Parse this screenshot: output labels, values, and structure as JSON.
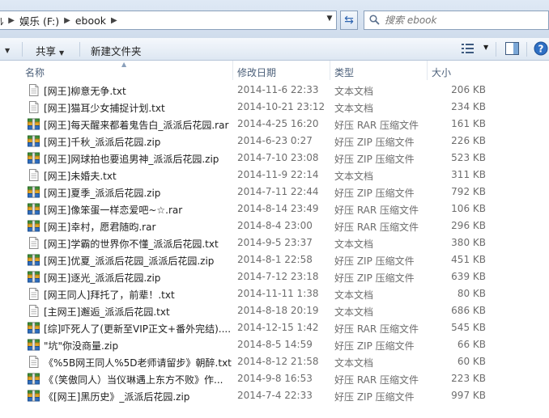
{
  "address": {
    "segments": [
      "ﾙ",
      "娱乐 (F:)",
      "ebook"
    ]
  },
  "search": {
    "placeholder": "搜索 ebook"
  },
  "toolbar": {
    "share_label": "共享",
    "new_folder_label": "新建文件夹"
  },
  "columns": {
    "name": "名称",
    "date": "修改日期",
    "type": "类型",
    "size": "大小"
  },
  "files": [
    {
      "name": "[网王]柳意无争.txt",
      "date": "2014-11-6 22:33",
      "type": "文本文档",
      "size": "206 KB",
      "icon": "text-file-icon"
    },
    {
      "name": "[网王]猫耳少女捕捉计划.txt",
      "date": "2014-10-21 23:12",
      "type": "文本文档",
      "size": "234 KB",
      "icon": "text-file-icon"
    },
    {
      "name": "[网王]每天醒来都着鬼告白_派派后花园.rar",
      "date": "2014-4-25 16:20",
      "type": "好压 RAR 压缩文件",
      "size": "161 KB",
      "icon": "archive-icon"
    },
    {
      "name": "[网王]千秋_派派后花园.zip",
      "date": "2014-6-23 0:27",
      "type": "好压 ZIP 压缩文件",
      "size": "226 KB",
      "icon": "archive-icon"
    },
    {
      "name": "[网王]网球拍也要追男神_派派后花园.zip",
      "date": "2014-7-10 23:08",
      "type": "好压 ZIP 压缩文件",
      "size": "523 KB",
      "icon": "archive-icon"
    },
    {
      "name": "[网王]未婚夫.txt",
      "date": "2014-11-9 22:14",
      "type": "文本文档",
      "size": "311 KB",
      "icon": "text-file-icon"
    },
    {
      "name": "[网王]夏季_派派后花园.zip",
      "date": "2014-7-11 22:44",
      "type": "好压 ZIP 压缩文件",
      "size": "792 KB",
      "icon": "archive-icon"
    },
    {
      "name": "[网王]像笨蛋一样恋爱吧~☆.rar",
      "date": "2014-8-14 23:49",
      "type": "好压 RAR 压缩文件",
      "size": "106 KB",
      "icon": "archive-icon"
    },
    {
      "name": "[网王]幸村，愿君随昀.rar",
      "date": "2014-8-4 23:00",
      "type": "好压 RAR 压缩文件",
      "size": "296 KB",
      "icon": "archive-icon"
    },
    {
      "name": "[网王]学霸的世界你不懂_派派后花园.txt",
      "date": "2014-9-5 23:37",
      "type": "文本文档",
      "size": "380 KB",
      "icon": "text-file-icon"
    },
    {
      "name": "[网王]优夏_派派后花园_派派后花园.zip",
      "date": "2014-8-1 22:58",
      "type": "好压 ZIP 压缩文件",
      "size": "451 KB",
      "icon": "archive-icon"
    },
    {
      "name": "[网王]逐光_派派后花园.zip",
      "date": "2014-7-12 23:18",
      "type": "好压 ZIP 压缩文件",
      "size": "639 KB",
      "icon": "archive-icon"
    },
    {
      "name": "[网王同人]拜托了，前辈！.txt",
      "date": "2014-11-11 1:38",
      "type": "文本文档",
      "size": "80 KB",
      "icon": "text-file-icon"
    },
    {
      "name": "[主网王]邂逅_派派后花园.txt",
      "date": "2014-8-18 20:19",
      "type": "文本文档",
      "size": "686 KB",
      "icon": "text-file-icon"
    },
    {
      "name": "[综]吓死人了(更新至VIP正文+番外完结)....",
      "date": "2014-12-15 1:42",
      "type": "好压 RAR 压缩文件",
      "size": "545 KB",
      "icon": "archive-icon"
    },
    {
      "name": "\"坑\"你没商量.zip",
      "date": "2014-8-5 14:59",
      "type": "好压 ZIP 压缩文件",
      "size": "66 KB",
      "icon": "archive-icon"
    },
    {
      "name": "《%5B网王同人%5D老师请留步》朝醉.txt",
      "date": "2014-8-12 21:58",
      "type": "文本文档",
      "size": "60 KB",
      "icon": "text-file-icon"
    },
    {
      "name": "《（笑傲同人）当仪琳遇上东方不败》作...",
      "date": "2014-9-8 16:53",
      "type": "好压 RAR 压缩文件",
      "size": "223 KB",
      "icon": "archive-icon"
    },
    {
      "name": "《[网王]黑历史》_派派后花园.zip",
      "date": "2014-7-4 22:33",
      "type": "好压 ZIP 压缩文件",
      "size": "997 KB",
      "icon": "archive-icon"
    }
  ]
}
